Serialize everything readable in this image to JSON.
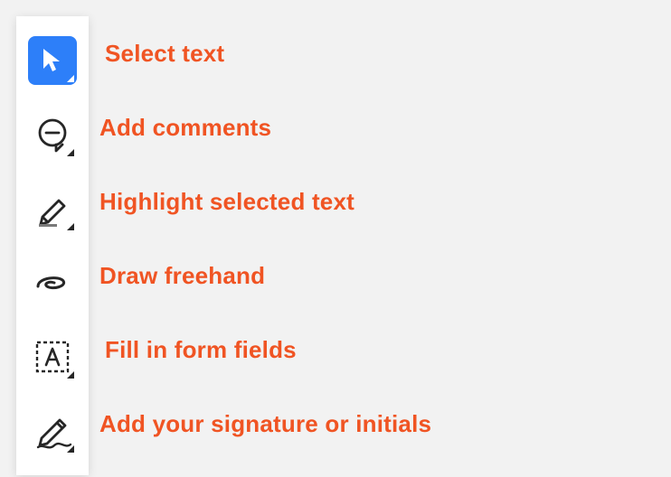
{
  "toolbar": {
    "items": [
      {
        "label": "Select text"
      },
      {
        "label": "Add comments"
      },
      {
        "label": "Highlight selected text"
      },
      {
        "label": "Draw freehand"
      },
      {
        "label": "Fill in form fields"
      },
      {
        "label": "Add your signature or initials"
      }
    ]
  }
}
